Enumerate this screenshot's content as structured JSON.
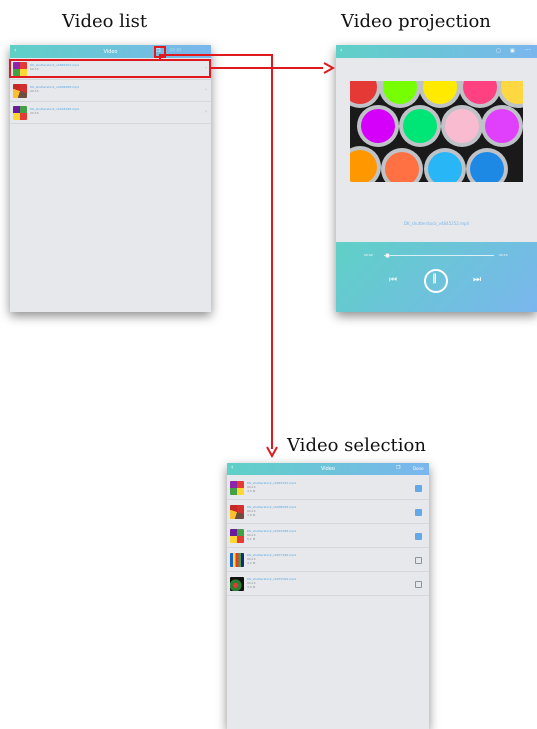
{
  "captions": {
    "list": "Video list",
    "projection": "Video projection",
    "selection": "Video selection"
  },
  "video_list": {
    "header_title": "Video",
    "items": [
      {
        "filename": "DK_shutterstock_v4845252.mp4",
        "meta": "00:15"
      },
      {
        "filename": "DK_shutterstock_v4006058.mp4",
        "meta": "00:15"
      },
      {
        "filename": "DK_shutterstock_v4018188.mp4",
        "meta": "00:15"
      }
    ]
  },
  "projection": {
    "filename": "DK_shutterstock_v4845252.mp4",
    "time_current": "00:00",
    "time_total": "00:15",
    "progress": 0.03
  },
  "selection": {
    "header_title": "Video",
    "done_label": "Done",
    "items": [
      {
        "filename": "DK_shutterstock_v4845252.mp4",
        "line2": "00:15",
        "line3": "4.5 M",
        "checked": true
      },
      {
        "filename": "DK_shutterstock_v4006058.mp4",
        "line2": "00:15",
        "line3": "3.8 M",
        "checked": true
      },
      {
        "filename": "DK_shutterstock_v4018188.mp4",
        "line2": "00:15",
        "line3": "5.1 M",
        "checked": true
      },
      {
        "filename": "DK_shutterstock_v4877496.mp4",
        "line2": "00:15",
        "line3": "4.2 M",
        "checked": false
      },
      {
        "filename": "DK_shutterstock_v4937009.mp4",
        "line2": "00:15",
        "line3": "3.9 M",
        "checked": false
      }
    ]
  },
  "colors": {
    "accent_teal": "#5fd0c6",
    "accent_blue": "#7ab6ee",
    "highlight_red": "#e0191e"
  },
  "icons": {
    "back": "chevron-left-icon",
    "multi_select": "multi-select-icon",
    "prev": "skip-previous-icon",
    "pause": "pause-icon",
    "next": "skip-next-icon"
  }
}
